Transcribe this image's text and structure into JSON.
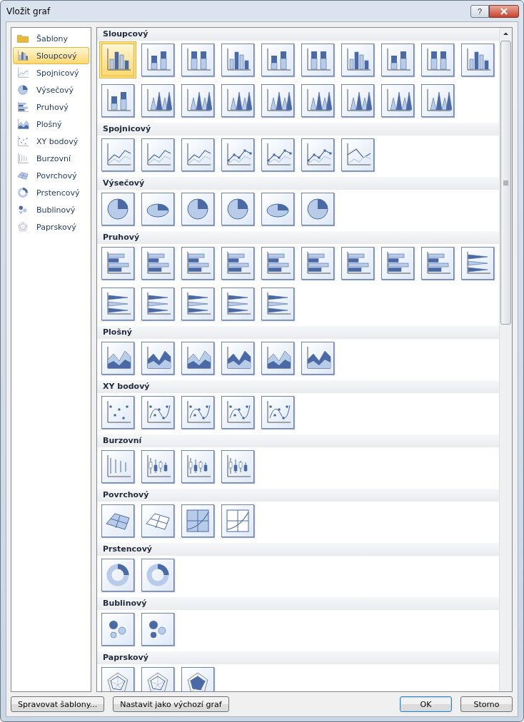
{
  "window": {
    "title": "Vložit graf",
    "help_button": "?"
  },
  "sidebar": {
    "items": [
      {
        "label": "Šablony",
        "kind": "templates",
        "selected": false
      },
      {
        "label": "Sloupcový",
        "kind": "column",
        "selected": true
      },
      {
        "label": "Spojnicový",
        "kind": "line",
        "selected": false
      },
      {
        "label": "Výsečový",
        "kind": "pie",
        "selected": false
      },
      {
        "label": "Pruhový",
        "kind": "bar",
        "selected": false
      },
      {
        "label": "Plošný",
        "kind": "area",
        "selected": false
      },
      {
        "label": "XY bodový",
        "kind": "scatter",
        "selected": false
      },
      {
        "label": "Burzovní",
        "kind": "stock",
        "selected": false
      },
      {
        "label": "Povrchový",
        "kind": "surface",
        "selected": false
      },
      {
        "label": "Prstencový",
        "kind": "doughnut",
        "selected": false
      },
      {
        "label": "Bublinový",
        "kind": "bubble",
        "selected": false
      },
      {
        "label": "Paprskový",
        "kind": "radar",
        "selected": false
      }
    ]
  },
  "sections": [
    {
      "title": "Sloupcový",
      "kind": "column",
      "thumbnails": [
        {
          "selected": true
        },
        {
          "selected": false
        },
        {
          "selected": false
        },
        {
          "selected": false
        },
        {
          "selected": false
        },
        {
          "selected": false
        },
        {
          "selected": false
        },
        {
          "selected": false
        },
        {
          "selected": false
        },
        {
          "selected": false
        },
        {
          "selected": false
        },
        {
          "selected": false
        },
        {
          "selected": false
        },
        {
          "selected": false
        },
        {
          "selected": false
        },
        {
          "selected": false
        },
        {
          "selected": false
        },
        {
          "selected": false
        },
        {
          "selected": false
        }
      ]
    },
    {
      "title": "Spojnicový",
      "kind": "line",
      "thumbnails": [
        {
          "selected": false
        },
        {
          "selected": false
        },
        {
          "selected": false
        },
        {
          "selected": false
        },
        {
          "selected": false
        },
        {
          "selected": false
        },
        {
          "selected": false
        }
      ]
    },
    {
      "title": "Výsečový",
      "kind": "pie",
      "thumbnails": [
        {
          "selected": false
        },
        {
          "selected": false
        },
        {
          "selected": false
        },
        {
          "selected": false
        },
        {
          "selected": false
        },
        {
          "selected": false
        }
      ]
    },
    {
      "title": "Pruhový",
      "kind": "bar",
      "thumbnails": [
        {
          "selected": false
        },
        {
          "selected": false
        },
        {
          "selected": false
        },
        {
          "selected": false
        },
        {
          "selected": false
        },
        {
          "selected": false
        },
        {
          "selected": false
        },
        {
          "selected": false
        },
        {
          "selected": false
        },
        {
          "selected": false
        },
        {
          "selected": false
        },
        {
          "selected": false
        },
        {
          "selected": false
        },
        {
          "selected": false
        },
        {
          "selected": false
        }
      ]
    },
    {
      "title": "Plošný",
      "kind": "area",
      "thumbnails": [
        {
          "selected": false
        },
        {
          "selected": false
        },
        {
          "selected": false
        },
        {
          "selected": false
        },
        {
          "selected": false
        },
        {
          "selected": false
        }
      ]
    },
    {
      "title": "XY bodový",
      "kind": "scatter",
      "thumbnails": [
        {
          "selected": false
        },
        {
          "selected": false
        },
        {
          "selected": false
        },
        {
          "selected": false
        },
        {
          "selected": false
        }
      ]
    },
    {
      "title": "Burzovní",
      "kind": "stock",
      "thumbnails": [
        {
          "selected": false
        },
        {
          "selected": false
        },
        {
          "selected": false
        },
        {
          "selected": false
        }
      ]
    },
    {
      "title": "Povrchový",
      "kind": "surface",
      "thumbnails": [
        {
          "selected": false
        },
        {
          "selected": false
        },
        {
          "selected": false
        },
        {
          "selected": false
        }
      ]
    },
    {
      "title": "Prstencový",
      "kind": "doughnut",
      "thumbnails": [
        {
          "selected": false
        },
        {
          "selected": false
        }
      ]
    },
    {
      "title": "Bublinový",
      "kind": "bubble",
      "thumbnails": [
        {
          "selected": false
        },
        {
          "selected": false
        }
      ]
    },
    {
      "title": "Paprskový",
      "kind": "radar",
      "thumbnails": [
        {
          "selected": false
        },
        {
          "selected": false
        },
        {
          "selected": false
        }
      ]
    }
  ],
  "buttons_left": [
    "Spravovat šablony...",
    "Nastavit jako výchozí graf"
  ],
  "buttons_right": [
    {
      "label": "OK",
      "default": true
    },
    {
      "label": "Storno",
      "default": false
    }
  ]
}
